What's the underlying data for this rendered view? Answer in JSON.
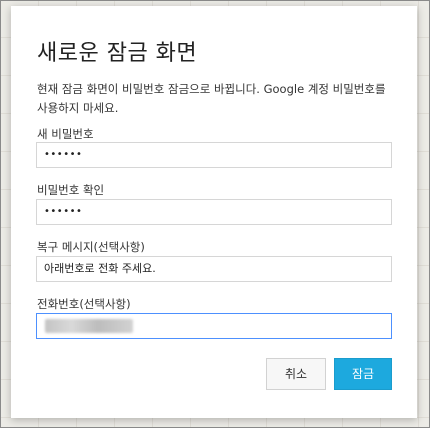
{
  "dialog": {
    "title": "새로운 잠금 화면",
    "description": "현재 잠금 화면이 비밀번호 잠금으로 바뀝니다. Google 계정 비밀번호를 사용하지 마세요.",
    "fields": {
      "new_password": {
        "label": "새 비밀번호",
        "value": "••••••"
      },
      "confirm_password": {
        "label": "비밀번호 확인",
        "value": "••••••"
      },
      "recovery_message": {
        "label": "복구 메시지(선택사항)",
        "value": "아래번호로 전화 주세요."
      },
      "phone_number": {
        "label": "전화번호(선택사항)",
        "value": ""
      }
    },
    "buttons": {
      "cancel": "취소",
      "lock": "잠금"
    }
  },
  "colors": {
    "accent": "#1da9de",
    "focus_border": "#4d90fe"
  }
}
